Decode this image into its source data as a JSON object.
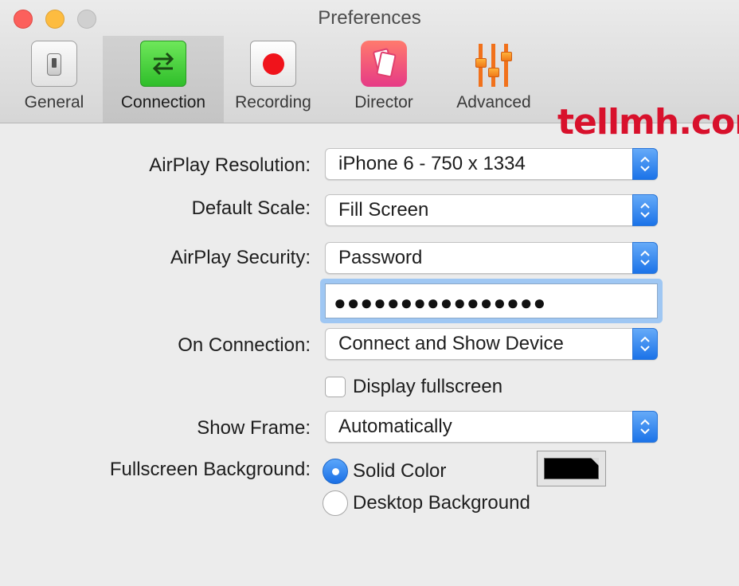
{
  "window": {
    "title": "Preferences"
  },
  "toolbar": {
    "tabs": [
      {
        "label": "General",
        "icon": "light-switch-icon"
      },
      {
        "label": "Connection",
        "icon": "swap-arrows-icon",
        "active": true
      },
      {
        "label": "Recording",
        "icon": "record-dot-icon"
      },
      {
        "label": "Director",
        "icon": "cards-icon"
      },
      {
        "label": "Advanced",
        "icon": "sliders-icon"
      }
    ]
  },
  "watermark": "tellmh.com",
  "form": {
    "resolution": {
      "label": "AirPlay Resolution:",
      "value": "iPhone 6 - 750 x 1334"
    },
    "scale": {
      "label": "Default Scale:",
      "value": "Fill Screen"
    },
    "security": {
      "label": "AirPlay Security:",
      "value": "Password",
      "password_mask": "●●●●●●●●●●●●●●●●"
    },
    "on_connection": {
      "label": "On Connection:",
      "value": "Connect and Show Device"
    },
    "fullscreen_checkbox": {
      "label": "Display fullscreen",
      "checked": false
    },
    "show_frame": {
      "label": "Show Frame:",
      "value": "Automatically"
    },
    "background": {
      "label": "Fullscreen Background:",
      "options": [
        {
          "label": "Solid Color",
          "selected": true
        },
        {
          "label": "Desktop Background",
          "selected": false
        }
      ],
      "color": "#000000"
    }
  },
  "colors": {
    "accent": "#1b73e8",
    "watermark": "#d8112c"
  }
}
